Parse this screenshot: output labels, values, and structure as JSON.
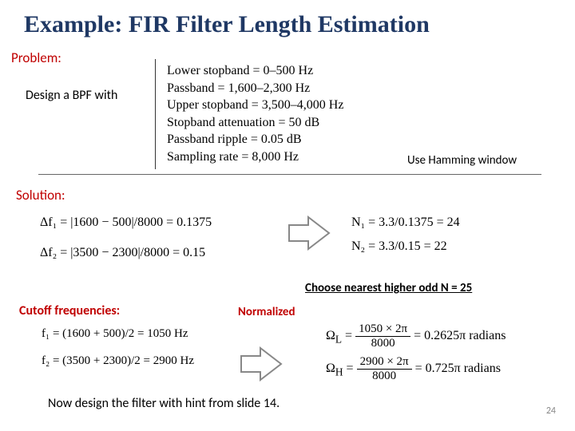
{
  "title": "Example: FIR Filter Length Estimation",
  "problem_label": "Problem:",
  "design_text": "Design a BPF with",
  "specs": {
    "l1": "Lower stopband = 0–500 Hz",
    "l2": "Passband = 1,600–2,300 Hz",
    "l3": "Upper stopband = 3,500–4,000 Hz",
    "l4": "Stopband attenuation = 50 dB",
    "l5": "Passband ripple = 0.05 dB",
    "l6": "Sampling rate = 8,000 Hz"
  },
  "use_hamming": "Use Hamming window",
  "solution_label": "Solution:",
  "delta_f1": "Δf₁ = |1600 − 500|/8000 = 0.1375",
  "delta_f2": "Δf₂ = |3500 − 2300|/8000 = 0.15",
  "n1": "N₁ = 3.3/0.1375 = 24",
  "n2": "N₂ = 3.3/0.15 = 22",
  "choose_n": "Choose nearest higher odd N = 25",
  "cutoff_label": "Cutoff frequencies:",
  "f1eq": "f₁ = (1600 + 500)/2 = 1050 Hz",
  "f2eq": "f₂ = (3500 + 2300)/2 = 2900 Hz",
  "normalized": "Normalized",
  "omega": {
    "L_num": "1050 × 2π",
    "L_den": "8000",
    "L_res": "= 0.2625π radians",
    "H_num": "2900 × 2π",
    "H_den": "8000",
    "H_res": "= 0.725π radians"
  },
  "closing": "Now design the filter with hint from slide 14.",
  "slidenum": "24"
}
